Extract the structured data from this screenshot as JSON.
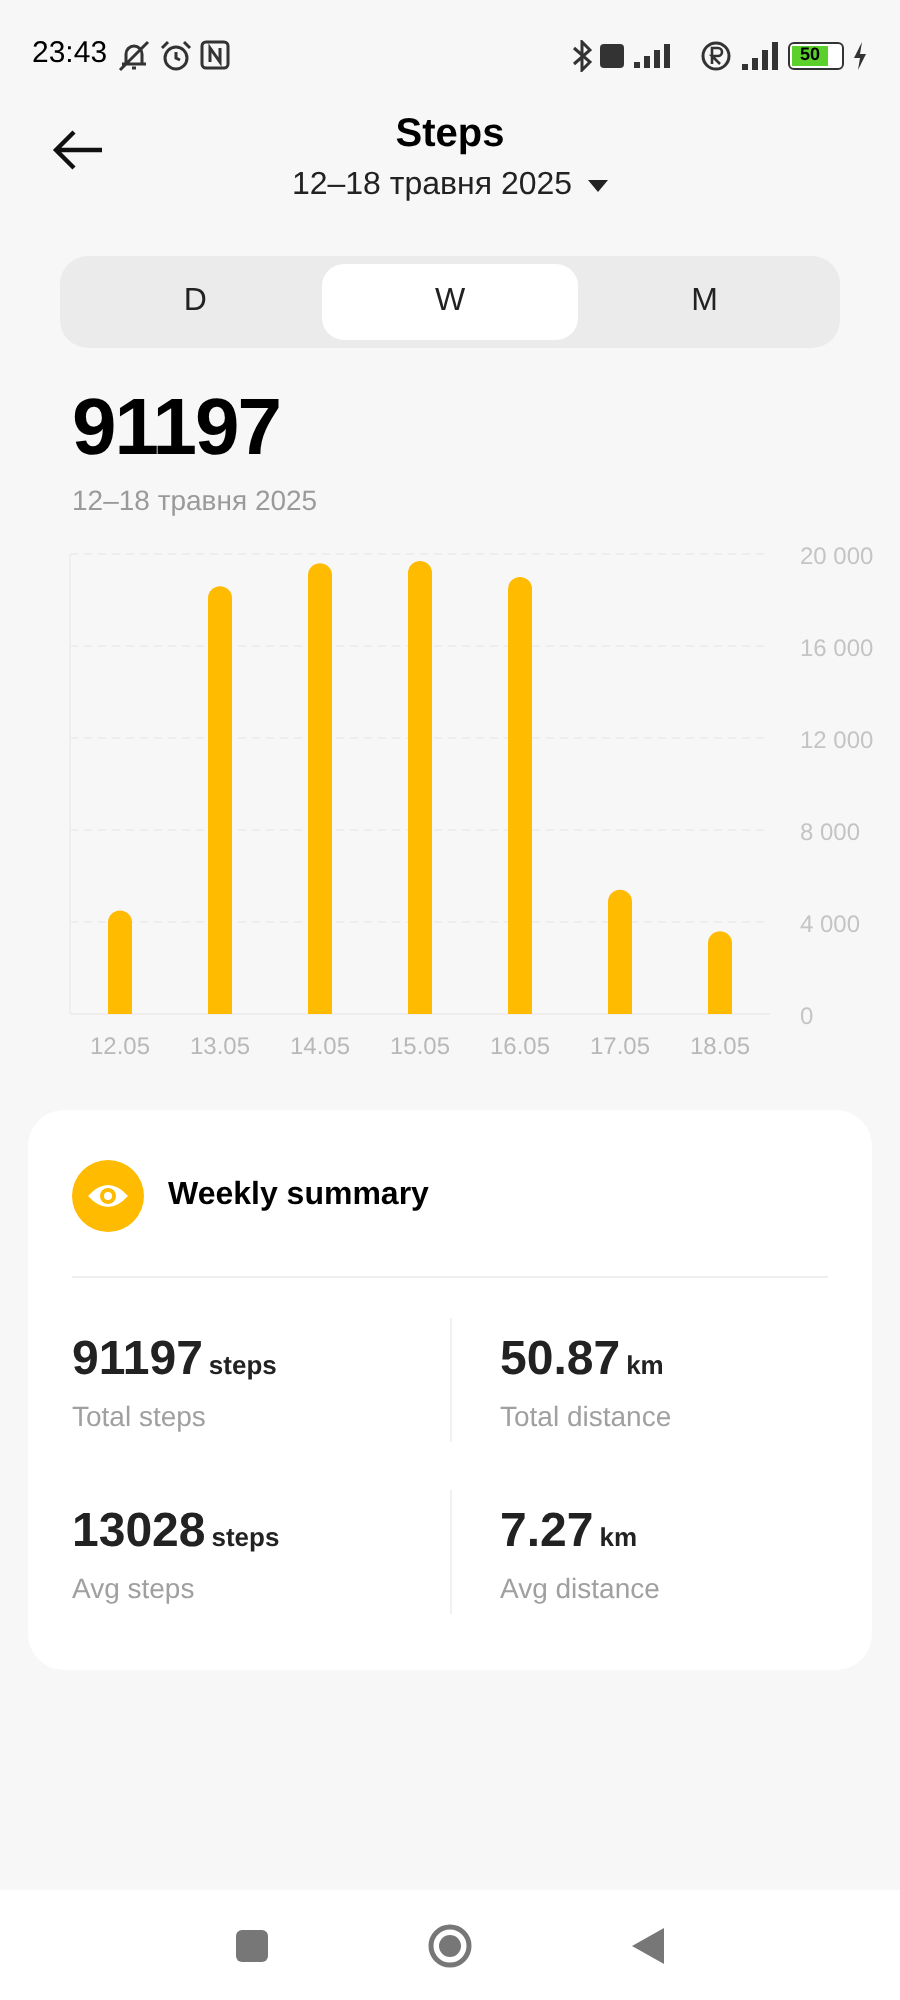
{
  "status_bar": {
    "time": "23:43",
    "battery": "50"
  },
  "header": {
    "title": "Steps",
    "period": "12–18 травня 2025"
  },
  "tabs": [
    {
      "label": "D",
      "selected": false
    },
    {
      "label": "W",
      "selected": true
    },
    {
      "label": "M",
      "selected": false
    }
  ],
  "total": {
    "value": "91197",
    "period": "12–18 травня 2025"
  },
  "chart_data": {
    "type": "bar",
    "categories": [
      "12.05",
      "13.05",
      "14.05",
      "15.05",
      "16.05",
      "17.05",
      "18.05"
    ],
    "series": [
      {
        "color": "#ffbb00",
        "values": [
          4500,
          18600,
          19600,
          19700,
          19000,
          5400,
          3600
        ]
      }
    ],
    "grid": true,
    "ylim": [
      0,
      20000
    ],
    "yticks": [
      {
        "value": 0,
        "label": "0"
      },
      {
        "value": 4000,
        "label": "4 000"
      },
      {
        "value": 8000,
        "label": "8 000"
      },
      {
        "value": 12000,
        "label": "12 000"
      },
      {
        "value": 16000,
        "label": "16 000"
      },
      {
        "value": 20000,
        "label": "20 000"
      }
    ]
  },
  "summary": {
    "title": "Weekly summary",
    "stats": [
      {
        "value": "91197",
        "unit": "steps",
        "label": "Total steps"
      },
      {
        "value": "50.87",
        "unit": "km",
        "label": "Total distance"
      },
      {
        "value": "13028",
        "unit": "steps",
        "label": "Avg steps"
      },
      {
        "value": "7.27",
        "unit": "km",
        "label": "Avg distance"
      }
    ]
  }
}
